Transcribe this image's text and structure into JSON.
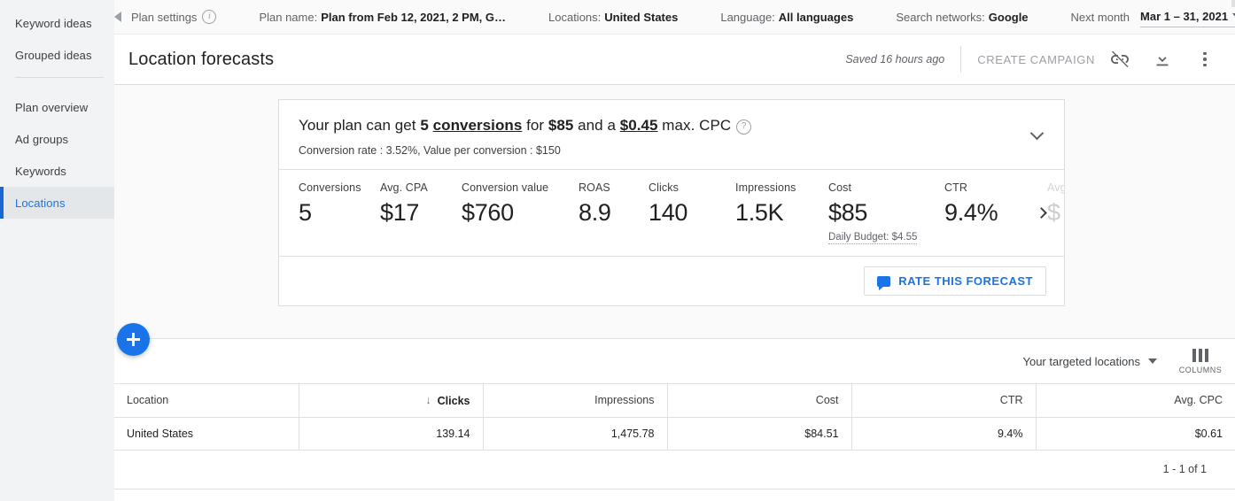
{
  "sidebar": {
    "groups": [
      {
        "items": [
          {
            "label": "Keyword ideas",
            "selected": false
          },
          {
            "label": "Grouped ideas",
            "selected": false
          }
        ]
      },
      {
        "items": [
          {
            "label": "Plan overview",
            "selected": false
          },
          {
            "label": "Ad groups",
            "selected": false
          },
          {
            "label": "Keywords",
            "selected": false
          },
          {
            "label": "Locations",
            "selected": true
          }
        ]
      }
    ]
  },
  "topbar": {
    "collapse_icon": "triangle-left-icon",
    "plan_settings_label": "Plan settings",
    "plan_settings_info_icon": "info-icon",
    "plan_name_label": "Plan name:",
    "plan_name_value": "Plan from Feb 12, 2021, 2 PM, G…",
    "locations_label": "Locations:",
    "locations_value": "United States",
    "language_label": "Language:",
    "language_value": "All languages",
    "networks_label": "Search networks:",
    "networks_value": "Google",
    "next_month_label": "Next month",
    "month_value": "Mar 1 – 31, 2021",
    "month_caret_icon": "caret-down-icon",
    "prev_icon": "chevron-left-icon",
    "next_icon": "chevron-right-icon"
  },
  "header": {
    "title": "Location forecasts",
    "saved_text": "Saved 16 hours ago",
    "create_campaign_label": "CREATE CAMPAIGN",
    "unlink_icon": "broken-link-icon",
    "download_icon": "download-icon",
    "more_icon": "more-vert-icon"
  },
  "forecast": {
    "headline": {
      "part1": "Your plan can get ",
      "conversions_count": "5",
      "conversions_word": "conversions",
      "part2": " for ",
      "cost": "$85",
      "part3": " and a ",
      "max_cpc": "$0.45",
      "part4": " max. CPC"
    },
    "help_icon": "help-icon",
    "subtitle": "Conversion rate : 3.52%, Value per conversion : $150",
    "collapse_icon": "chevron-down-icon",
    "metrics": [
      {
        "label": "Conversions",
        "value": "5",
        "note": ""
      },
      {
        "label": "Avg. CPA",
        "value": "$17",
        "note": ""
      },
      {
        "label": "Conversion value",
        "value": "$760",
        "note": ""
      },
      {
        "label": "ROAS",
        "value": "8.9",
        "note": ""
      },
      {
        "label": "Clicks",
        "value": "140",
        "note": ""
      },
      {
        "label": "Impressions",
        "value": "1.5K",
        "note": ""
      },
      {
        "label": "Cost",
        "value": "$85",
        "note": "Daily Budget: $4.55"
      },
      {
        "label": "CTR",
        "value": "9.4%",
        "note": ""
      },
      {
        "label": "Avg.",
        "value": "$",
        "note": ""
      }
    ],
    "metrics_next_icon": "chevron-right-icon",
    "rate_button_label": "RATE THIS FORECAST",
    "rate_button_icon": "feedback-icon"
  },
  "table_toolbar": {
    "add_icon": "plus-icon",
    "locations_dropdown_label": "Your targeted locations",
    "locations_dropdown_icon": "caret-down-icon",
    "columns_label": "COLUMNS",
    "columns_icon": "columns-icon"
  },
  "table": {
    "columns": [
      {
        "label": "Location",
        "align": "left",
        "sorted": false
      },
      {
        "label": "Clicks",
        "align": "right",
        "sorted": true,
        "sort_icon": "↓"
      },
      {
        "label": "Impressions",
        "align": "right",
        "sorted": false
      },
      {
        "label": "Cost",
        "align": "right",
        "sorted": false
      },
      {
        "label": "CTR",
        "align": "right",
        "sorted": false
      },
      {
        "label": "Avg. CPC",
        "align": "right",
        "sorted": false
      }
    ],
    "rows": [
      [
        "United States",
        "139.14",
        "1,475.78",
        "$84.51",
        "9.4%",
        "$0.61"
      ]
    ],
    "pagination": "1 - 1 of 1"
  },
  "colors": {
    "accent": "#1a73e8",
    "selected_nav": "#1967d2",
    "sidebar_bg": "#f1f3f4",
    "page_bg": "#fafafa",
    "border": "#dadce0"
  }
}
